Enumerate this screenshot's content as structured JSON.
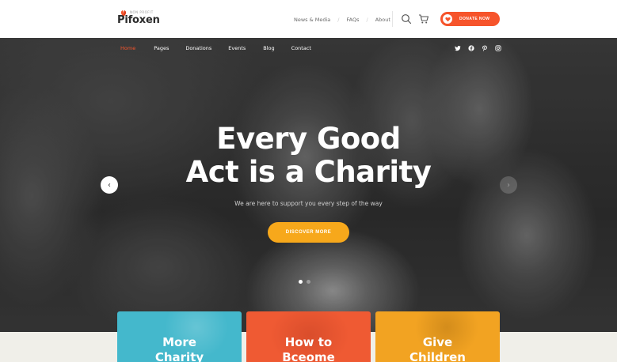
{
  "brand": {
    "name": "Pifoxen",
    "tagline": "NON PROFIT",
    "accent": "#f6542b"
  },
  "toplinks": [
    {
      "label": "News & Media"
    },
    {
      "label": "FAQs"
    },
    {
      "label": "About"
    }
  ],
  "toplink_separator": "/",
  "icons": {
    "search": "search-icon",
    "cart": "cart-icon",
    "heart": "heart-icon"
  },
  "donate_button": {
    "label": "DONATE NOW",
    "color": "#f6542b"
  },
  "nav": {
    "items": [
      {
        "label": "Home",
        "active": true
      },
      {
        "label": "Pages",
        "active": false
      },
      {
        "label": "Donations",
        "active": false
      },
      {
        "label": "Events",
        "active": false
      },
      {
        "label": "Blog",
        "active": false
      },
      {
        "label": "Contact",
        "active": false
      }
    ]
  },
  "social": [
    "twitter-icon",
    "facebook-icon",
    "pinterest-icon",
    "instagram-icon"
  ],
  "hero": {
    "title_line1": "Every Good",
    "title_line2": "Act is a Charity",
    "subtitle": "We are here to support you every step of the way",
    "cta_label": "DISCOVER MORE",
    "cta_color": "#f7a81b",
    "prev_arrow": "‹",
    "next_arrow": "›",
    "slides_total": 2,
    "active_slide": 1
  },
  "cards": [
    {
      "line1": "More",
      "line2": "Charity",
      "color": "#44b8cc"
    },
    {
      "line1": "How to",
      "line2": "Bceome",
      "color": "#ef5a33"
    },
    {
      "line1": "Give",
      "line2": "Children",
      "color": "#f2a322"
    }
  ]
}
